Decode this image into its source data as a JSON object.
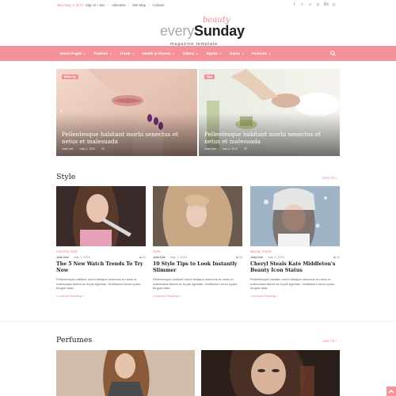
{
  "topbar": {
    "date": "Wed May 3, 2017",
    "links": [
      "Sign in / Join",
      "Advertise",
      "Site Map",
      "Contact"
    ],
    "social_icons": [
      "facebook-icon",
      "twitter-icon",
      "vimeo-icon",
      "pinterest-icon",
      "behance-icon",
      "instagram-icon"
    ]
  },
  "logo": {
    "beauty": "beauty",
    "every": "every",
    "sunday": "Sunday",
    "tagline": "magazine template"
  },
  "nav": {
    "items": [
      "Home Pages",
      "Fashion",
      "Travel",
      "Health & Fitness",
      "Videos",
      "Sports",
      "Autos",
      "Features"
    ]
  },
  "hero": {
    "slides": [
      {
        "badge": "Make Up",
        "title": "Pellentesque habitant morbi senectus et netus et malesuada",
        "author": "Julia Doe",
        "date": "may 1, 2016",
        "comments": "20"
      },
      {
        "badge": "Spa",
        "title": "Pellentesque habitant morbi senectus et netus et malesuada",
        "author": "Julia Doe",
        "date": "may 1, 2016",
        "comments": "20"
      }
    ]
  },
  "style_section": {
    "title": "Style",
    "view_all": "View All »",
    "cards": [
      {
        "category": "Celebrity Style",
        "author": "Julia Doe",
        "date": "may 1, 2016",
        "comments": "20",
        "title": "The 5 New Watch Trends To Try Now",
        "excerpt": "Pellentesque habitant morbi tristique senectus et netus et malesuada fames ac turpis egestas. Vestibulum tortor quam, feugiat vitae.",
        "more": "Continue Reading »"
      },
      {
        "category": "Style",
        "author": "Julia Doe",
        "date": "may 1, 2016",
        "comments": "20",
        "title": "10 Style Tips to Look Instantly Slimmer",
        "excerpt": "Pellentesque habitant morbi tristique senectus et netus et malesuada fames ac turpis egestas. Vestibulum tortor quam, feugiat vitae.",
        "more": "Continue Reading »"
      },
      {
        "category": "Beauty Trends",
        "author": "Julia Doe",
        "date": "may 1, 2016",
        "comments": "20",
        "title": "Cheryl Steals Kate Middleton's Beauty Icon Status",
        "excerpt": "Pellentesque habitant morbi tristique senectus et netus et malesuada fames ac turpis egestas. Vestibulum tortor quam, feugiat vitae.",
        "more": "Continue Reading »"
      }
    ]
  },
  "perfumes_section": {
    "title": "Perfumes",
    "view_all": "View All »"
  },
  "colors": {
    "accent": "#f4929a",
    "accent_text": "#e9868f"
  }
}
